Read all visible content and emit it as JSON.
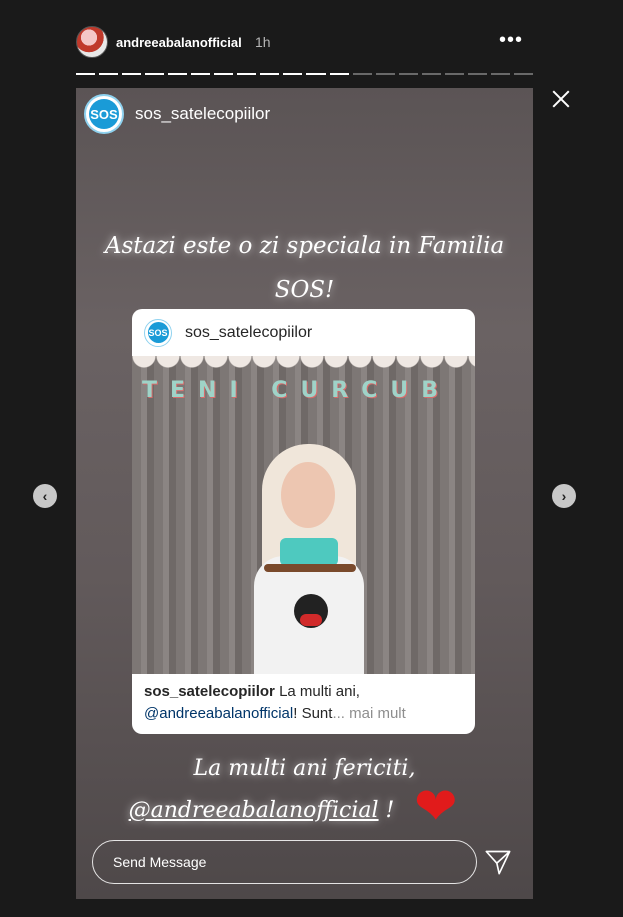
{
  "header": {
    "username": "andreeabalanofficial",
    "time": "1h",
    "more_label": "•••"
  },
  "progress": {
    "total_segments": 20,
    "completed_segments": 12
  },
  "nav": {
    "prev_label": "‹",
    "next_label": "›"
  },
  "story": {
    "owner_initials": "SOS",
    "owner_name": "sos_satelecopiilor",
    "text_top_line1": "Astazi este o zi speciala in Familia",
    "text_top_line2": "SOS!",
    "text_bottom_line1": "La multi ani fericiti,",
    "text_bottom_mention": "@andreeabalanofficial",
    "text_bottom_end": " !",
    "sticker": "❤"
  },
  "card": {
    "username": "sos_satelecopiilor",
    "photo_title": "TENI CURCUB",
    "caption_user": "sos_satelecopiilor",
    "caption_text": " La multi ani,",
    "caption_mention": "@andreeabalanofficial",
    "caption_rest": "! Sunt",
    "caption_more": "... mai mult"
  },
  "reply": {
    "placeholder": "Send Message"
  },
  "icons": {
    "close": "close-icon",
    "send": "paper-plane-icon",
    "more": "more-horizontal-icon"
  },
  "colors": {
    "background": "#1a1a1a",
    "link": "#003569",
    "heart": "#e11b1b"
  }
}
